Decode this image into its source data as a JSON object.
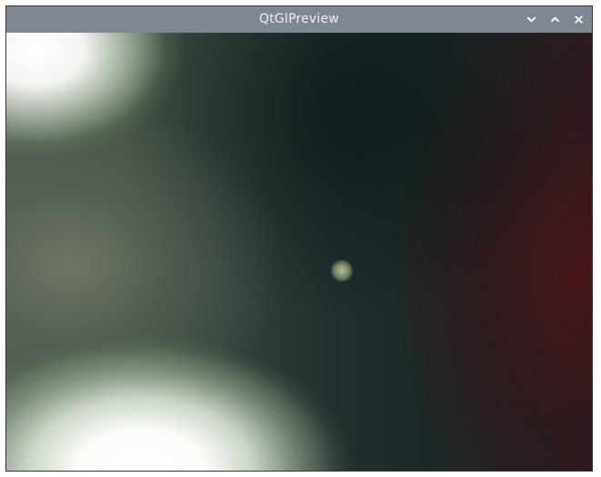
{
  "window": {
    "title": "QtGlPreview",
    "controls": {
      "minimize_icon": "chevron-down-icon",
      "maximize_icon": "chevron-up-icon",
      "close_icon": "close-icon"
    }
  },
  "colors": {
    "titlebar": "#7f8792",
    "title_text": "#eef1f4",
    "preview_dark": "#1e2626",
    "preview_red": "#4c1418",
    "preview_bright": "#ffffff"
  }
}
